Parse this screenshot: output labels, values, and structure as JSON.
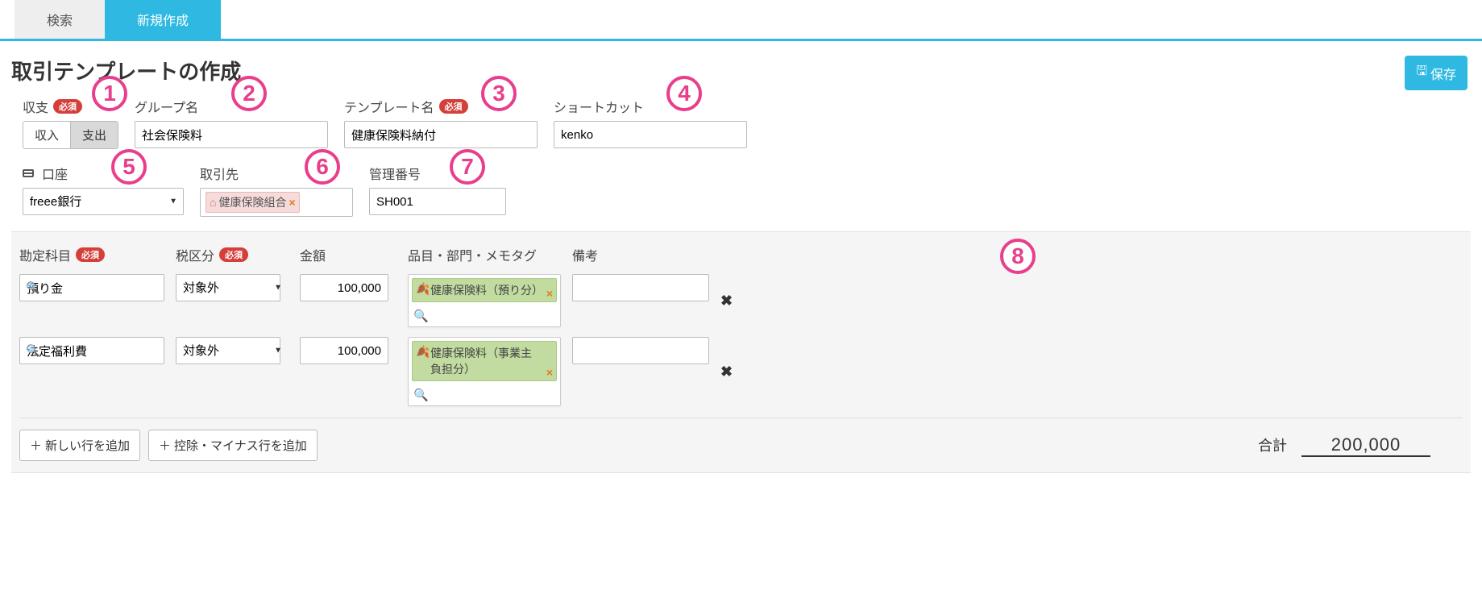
{
  "tabs": {
    "search": "検索",
    "create": "新規作成"
  },
  "title": "取引テンプレートの作成",
  "save_label": "保存",
  "required_badge": "必須",
  "labels": {
    "balance": "収支",
    "income": "収入",
    "expense": "支出",
    "group_name": "グループ名",
    "template_name": "テンプレート名",
    "shortcut": "ショートカット",
    "account": "口座",
    "partner": "取引先",
    "mgmt_no": "管理番号"
  },
  "values": {
    "group_name": "社会保険料",
    "template_name": "健康保険料納付",
    "shortcut": "kenko",
    "account": "freee銀行",
    "partner_tag": "健康保険組合",
    "mgmt_no": "SH001"
  },
  "line_headers": {
    "account_item": "勘定科目",
    "tax": "税区分",
    "amount": "金額",
    "tags": "品目・部門・メモタグ",
    "note": "備考"
  },
  "lines": [
    {
      "account_item": "預り金",
      "tax": "対象外",
      "amount": "100,000",
      "tag": "健康保険料（預り分）",
      "note": ""
    },
    {
      "account_item": "法定福利費",
      "tax": "対象外",
      "amount": "100,000",
      "tag": "健康保険料（事業主負担分）",
      "note": ""
    }
  ],
  "footer": {
    "add_row": "新しい行を追加",
    "add_deduction": "控除・マイナス行を追加",
    "total_label": "合計",
    "total_value": "200,000"
  },
  "annotations": [
    "1",
    "2",
    "3",
    "4",
    "5",
    "6",
    "7",
    "8"
  ]
}
